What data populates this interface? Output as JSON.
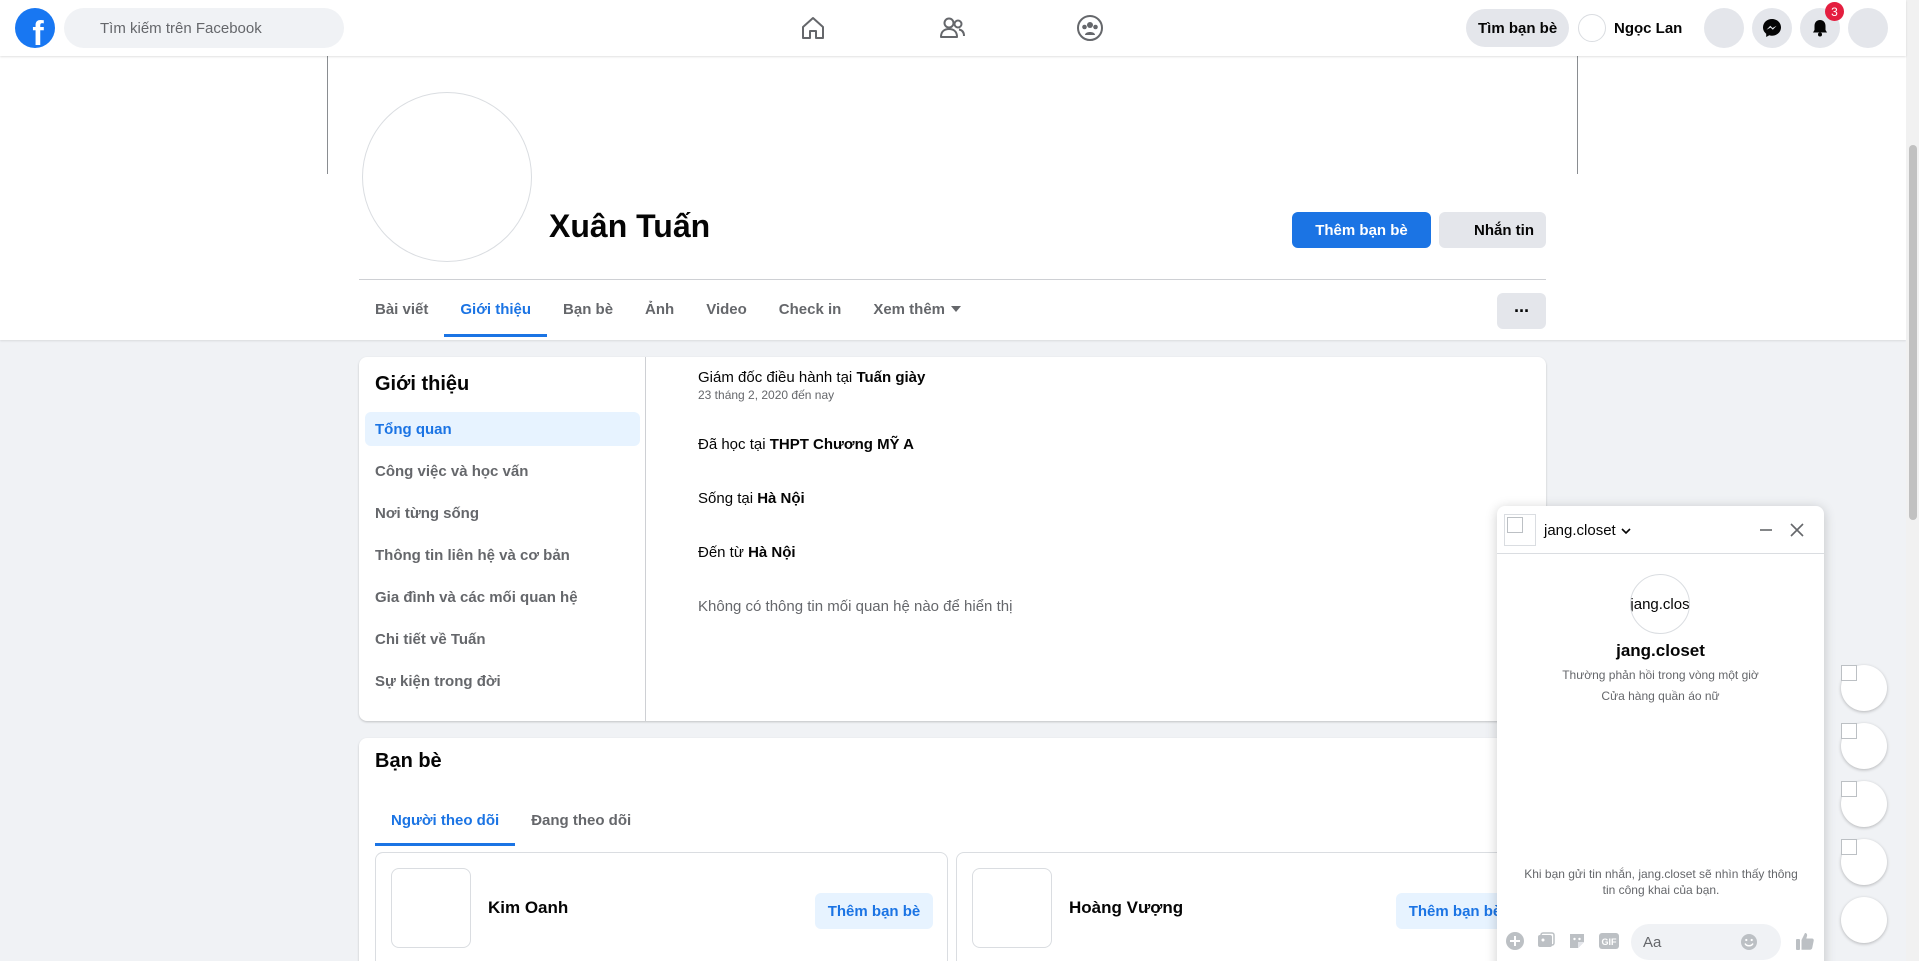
{
  "topnav": {
    "logo_letter": "f",
    "search_placeholder": "Tìm kiếm trên Facebook",
    "find_friends_label": "Tìm bạn bè",
    "user_name": "Ngọc Lan",
    "notification_count": "3"
  },
  "profile": {
    "name": "Xuân Tuấn",
    "add_friend_label": "Thêm bạn bè",
    "message_label": "Nhắn tin",
    "more_label": "···",
    "tabs": [
      "Bài viết",
      "Giới thiệu",
      "Bạn bè",
      "Ảnh",
      "Video",
      "Check in",
      "Xem thêm"
    ],
    "active_tab": "Giới thiệu"
  },
  "intro": {
    "title": "Giới thiệu",
    "menu": [
      "Tổng quan",
      "Công việc và học vấn",
      "Nơi từng sống",
      "Thông tin liên hệ và cơ bản",
      "Gia đình và các mối quan hệ",
      "Chi tiết về Tuấn",
      "Sự kiện trong đời"
    ],
    "active_menu": "Tổng quan",
    "work_prefix": "Giám đốc điều hành tại ",
    "work_place": "Tuấn giày",
    "work_since": "23 tháng 2, 2020 đến nay",
    "school_prefix": "Đã học tại ",
    "school_name": "THPT Chương MỸ A",
    "lives_prefix": "Sống tại ",
    "lives_place": "Hà Nội",
    "from_prefix": "Đến từ ",
    "from_place": "Hà Nội",
    "relationship_empty": "Không có thông tin mối quan hệ nào để hiển thị"
  },
  "friends": {
    "title": "Bạn bè",
    "tabs": [
      "Người theo dõi",
      "Đang theo dõi"
    ],
    "active_tab": "Người theo dõi",
    "items": [
      {
        "name": "Kim Oanh",
        "action": "Thêm bạn bè"
      },
      {
        "name": "Hoàng Vượng",
        "action": "Thêm bạn bè"
      }
    ]
  },
  "chat": {
    "header_name": "jang.closet",
    "avatar_alt": "jang.clos",
    "title": "jang.closet",
    "response_time": "Thường phản hồi trong vòng một giờ",
    "category": "Cửa hàng quần áo nữ",
    "notice": "Khi bạn gửi tin nhắn, jang.closet sẽ nhìn thấy thông tin công khai của bạn.",
    "input_placeholder": "Aa",
    "gif_label": "GIF"
  },
  "colors": {
    "brand_blue": "#1877f2",
    "accent_blue": "#1b74e4",
    "badge_red": "#e41e3f",
    "bg_gray": "#f0f2f5"
  }
}
